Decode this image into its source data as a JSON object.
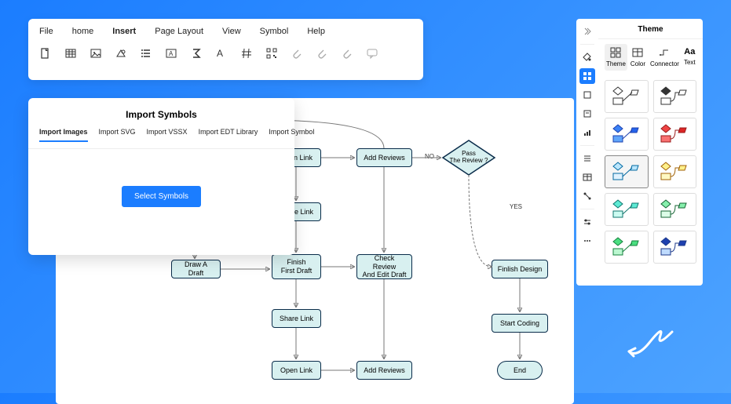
{
  "menu": {
    "items": [
      "File",
      "home",
      "Insert",
      "Page Layout",
      "View",
      "Symbol",
      "Help"
    ],
    "active_index": 2
  },
  "toolbar_icons": [
    "blank-page",
    "table",
    "image",
    "shape",
    "list",
    "text-box",
    "sigma",
    "font",
    "hash",
    "qr",
    "link1",
    "link2",
    "link3",
    "comment"
  ],
  "dialog": {
    "title": "Import Symbols",
    "tabs": [
      "Import Images",
      "Import SVG",
      "Import VSSX",
      "Import EDT Library",
      "Import Symbol"
    ],
    "active_tab": 0,
    "button": "Select Symbols"
  },
  "flow": {
    "nodes": {
      "draw": "Draw A Draft",
      "open_link_top": "Open Link",
      "share_link_top": "Share Link",
      "finish_first": "Finish\nFirst Draft",
      "share_link_mid": "Share Link",
      "open_link_bot": "Open Link",
      "add_reviews_top": "Add Reviews",
      "check_review": "Check Review\nAnd Edit Draft",
      "add_reviews_bot": "Add Reviews",
      "decision": "Pass\nThe Review ?",
      "finish_design": "Finlish Design",
      "start_coding": "Start Coding",
      "end": "End"
    },
    "labels": {
      "no": "NO",
      "yes": "YES"
    }
  },
  "theme_panel": {
    "title": "Theme",
    "tabs": [
      {
        "label": "Theme",
        "icon": "grid"
      },
      {
        "label": "Color",
        "icon": "table"
      },
      {
        "label": "Connector",
        "icon": "connector"
      },
      {
        "label": "Text",
        "icon": "Aa"
      }
    ],
    "active_tab": 0
  },
  "side_icons": [
    "collapse",
    "paint-bucket",
    "grid",
    "layers",
    "text",
    "chart",
    "list-alt",
    "table-alt",
    "node",
    "settings",
    "ruler"
  ]
}
